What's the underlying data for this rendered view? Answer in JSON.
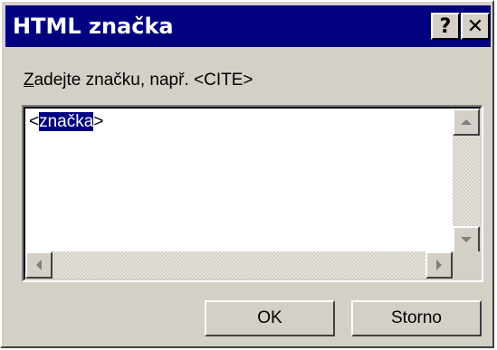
{
  "window": {
    "title": "HTML značka",
    "help_label": "?",
    "close_label": "✕"
  },
  "prompt": {
    "accelerator": "Z",
    "rest": "adejte značku, např. <CITE>"
  },
  "editor": {
    "open_bracket": "<",
    "selected_text": "značka",
    "close_bracket": ">"
  },
  "buttons": {
    "ok_label": "OK",
    "cancel_label": "Storno"
  },
  "icons": {
    "help": "help-icon",
    "close": "close-icon",
    "scroll_up": "scroll-up-arrow-icon",
    "scroll_down": "scroll-down-arrow-icon",
    "scroll_left": "scroll-left-arrow-icon",
    "scroll_right": "scroll-right-arrow-icon"
  },
  "colors": {
    "titlebar": "#000080",
    "face": "#d4d0c8",
    "selection": "#000080"
  }
}
